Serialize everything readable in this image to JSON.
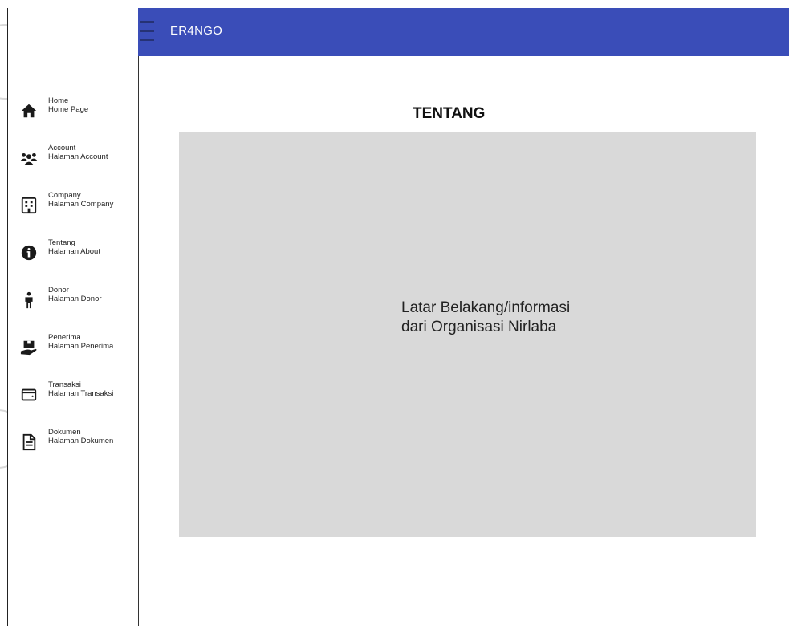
{
  "header": {
    "app_title": "ER4NGO",
    "accent_color": "#3a4db8"
  },
  "sidebar": {
    "items": [
      {
        "icon": "home-icon",
        "title": "Home",
        "subtitle": "Home Page"
      },
      {
        "icon": "users-icon",
        "title": "Account",
        "subtitle": "Halaman Account"
      },
      {
        "icon": "building-icon",
        "title": "Company",
        "subtitle": "Halaman Company"
      },
      {
        "icon": "info-icon",
        "title": "Tentang",
        "subtitle": "Halaman About"
      },
      {
        "icon": "person-icon",
        "title": "Donor",
        "subtitle": "Halaman Donor"
      },
      {
        "icon": "hand-box-icon",
        "title": "Penerima",
        "subtitle": "Halaman Penerima"
      },
      {
        "icon": "wallet-icon",
        "title": "Transaksi",
        "subtitle": "Halaman Transaksi"
      },
      {
        "icon": "document-icon",
        "title": "Dokumen",
        "subtitle": "Halaman Dokumen"
      }
    ]
  },
  "main": {
    "title": "TENTANG",
    "content_text": "Latar Belakang/informasi\ndari Organisasi Nirlaba",
    "content_bg": "#d9d9d9"
  }
}
